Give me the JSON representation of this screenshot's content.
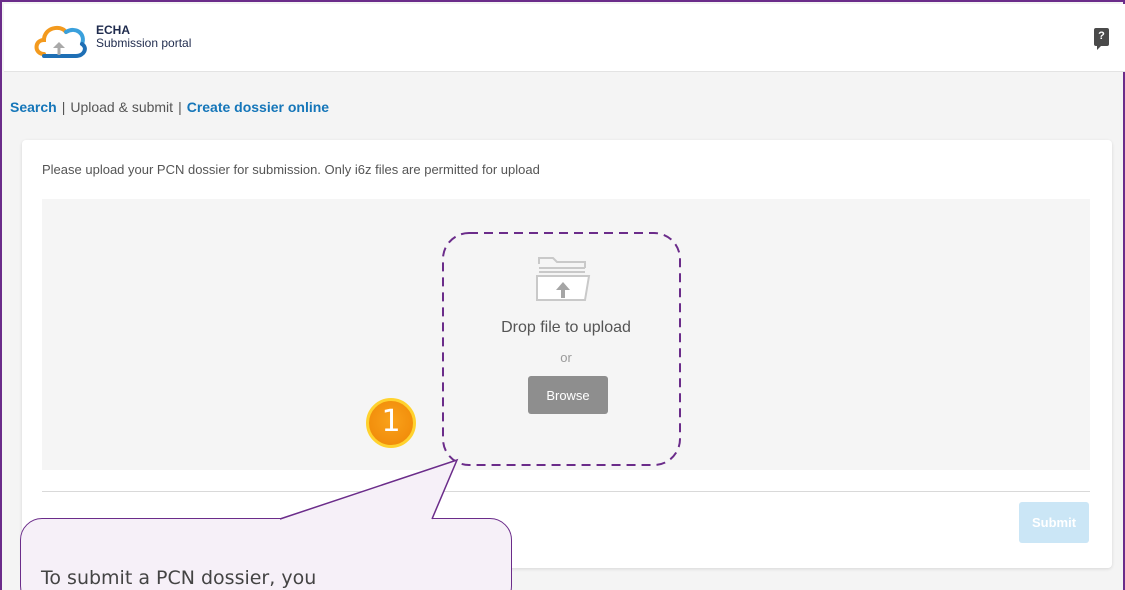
{
  "header": {
    "brand_name": "ECHA",
    "brand_sub": "Submission portal",
    "help_label": "?"
  },
  "subnav": {
    "search": "Search",
    "separator": "|",
    "upload_submit": "Upload & submit",
    "create_online": "Create dossier online"
  },
  "upload": {
    "instruction": "Please upload your PCN dossier for submission. Only i6z files are permitted for upload",
    "drop_text": "Drop file to upload",
    "or_text": "or",
    "browse_label": "Browse",
    "submit_label": "Submit"
  },
  "annotation": {
    "step_number": "1",
    "callout_text": "To submit a PCN dossier, you"
  },
  "colors": {
    "frame": "#6b2c8a",
    "link": "#1576b9",
    "browse_button": "#8e8e8e",
    "submit_button_disabled": "#cbe6f6",
    "badge": "#f28e0c",
    "badge_ring": "#ffd22e"
  },
  "icons": {
    "logo": "cloud-upload-logo-icon",
    "help": "help-question-icon",
    "folder": "folder-upload-icon"
  }
}
